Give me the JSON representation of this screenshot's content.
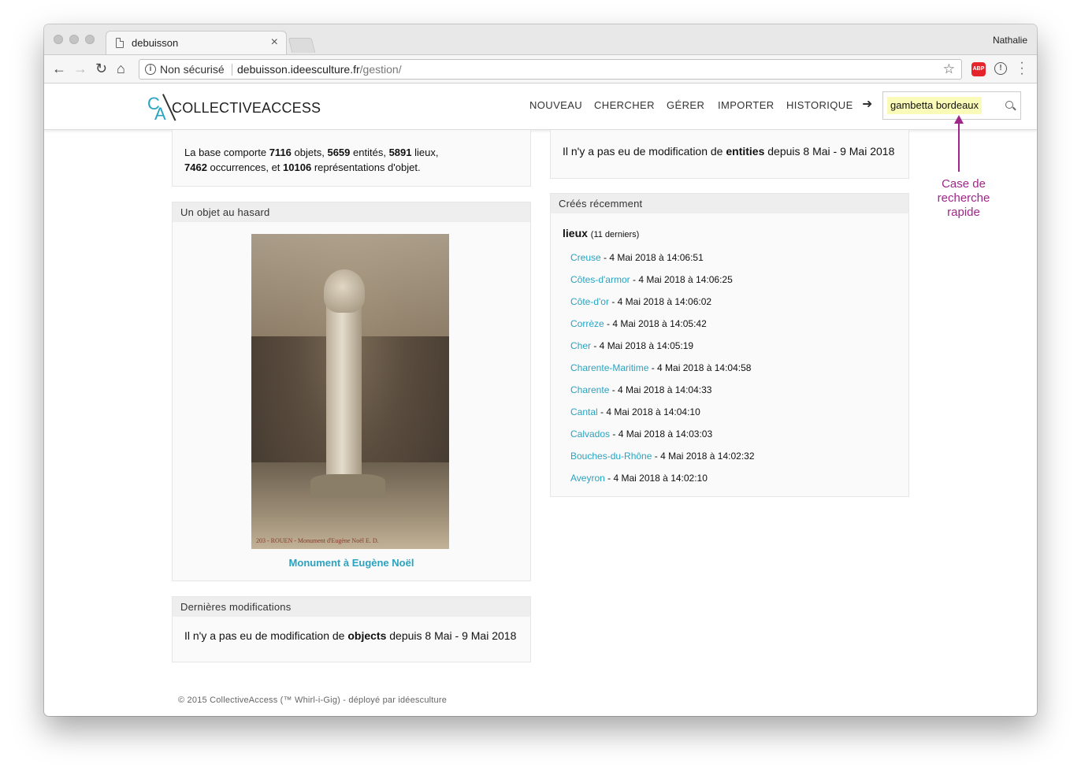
{
  "browser": {
    "tab_title": "debuisson",
    "tab_close": "×",
    "profile_name": "Nathalie",
    "security_label": "Non sécurisé",
    "url_domain": "debuisson.ideesculture.fr",
    "url_path": "/gestion/",
    "abp_label": "ABP"
  },
  "header": {
    "logo_c": "C",
    "logo_a": "A",
    "logo_text": "COLLECTIVEACCESS",
    "nav": {
      "nouveau": "NOUVEAU",
      "chercher": "CHERCHER",
      "gerer": "GÉRER",
      "importer": "IMPORTER",
      "historique": "HISTORIQUE"
    },
    "arrow": "➜",
    "search_value": "gambetta bordeaux"
  },
  "stats": {
    "prefix": "La base comporte",
    "objets_count": "7116",
    "objets_label": "objets,",
    "entites_count": "5659",
    "entites_label": "entités,",
    "lieux_count": "5891",
    "lieux_label": "lieux,",
    "occurrences_count": "7462",
    "occurrences_label": "occurrences, et",
    "representations_count": "10106",
    "representations_label": "représentations d'objet."
  },
  "random_object": {
    "heading": "Un objet au hasard",
    "image_caption": "203 - ROUEN - Monument d'Eugène Noël          E. D.",
    "title": "Monument à Eugène Noël"
  },
  "latest_changes": {
    "heading": "Dernières modifications",
    "prefix": "Il n'y a pas eu de modification de",
    "kind": "objects",
    "suffix": "depuis 8 Mai - 9 Mai 2018"
  },
  "entities_changes": {
    "prefix": "Il n'y a pas eu de modification de",
    "kind": "entities",
    "suffix": "depuis 8 Mai - 9 Mai 2018"
  },
  "recent": {
    "heading": "Créés récemment",
    "section_title": "lieux",
    "section_count": "(11 derniers)",
    "items": [
      {
        "name": "Creuse",
        "date": " - 4 Mai 2018 à 14:06:51"
      },
      {
        "name": "Côtes-d'armor",
        "date": " - 4 Mai 2018 à 14:06:25"
      },
      {
        "name": "Côte-d'or",
        "date": " - 4 Mai 2018 à 14:06:02"
      },
      {
        "name": "Corrèze",
        "date": " - 4 Mai 2018 à 14:05:42"
      },
      {
        "name": "Cher",
        "date": " - 4 Mai 2018 à 14:05:19"
      },
      {
        "name": "Charente-Maritime",
        "date": " - 4 Mai 2018 à 14:04:58"
      },
      {
        "name": "Charente",
        "date": " - 4 Mai 2018 à 14:04:33"
      },
      {
        "name": "Cantal",
        "date": " - 4 Mai 2018 à 14:04:10"
      },
      {
        "name": "Calvados",
        "date": " - 4 Mai 2018 à 14:03:03"
      },
      {
        "name": "Bouches-du-Rhône",
        "date": " - 4 Mai 2018 à 14:02:32"
      },
      {
        "name": "Aveyron",
        "date": " - 4 Mai 2018 à 14:02:10"
      }
    ]
  },
  "footer": {
    "text": "© 2015 CollectiveAccess (™ Whirl-i-Gig) - déployé par idéesculture"
  },
  "annotation": {
    "line1": "Case de",
    "line2": "recherche",
    "line3": "rapide"
  },
  "colors": {
    "link": "#2aa3c0",
    "annotation": "#a0268a",
    "search_highlight": "#fbfbb9"
  },
  "icons": [
    "document-icon",
    "close-icon",
    "back-arrow-icon",
    "forward-arrow-icon",
    "reload-icon",
    "home-icon",
    "info-icon",
    "star-icon",
    "adblock-icon",
    "extension-icon",
    "menu-dots-icon",
    "arrow-right-icon",
    "search-icon"
  ]
}
